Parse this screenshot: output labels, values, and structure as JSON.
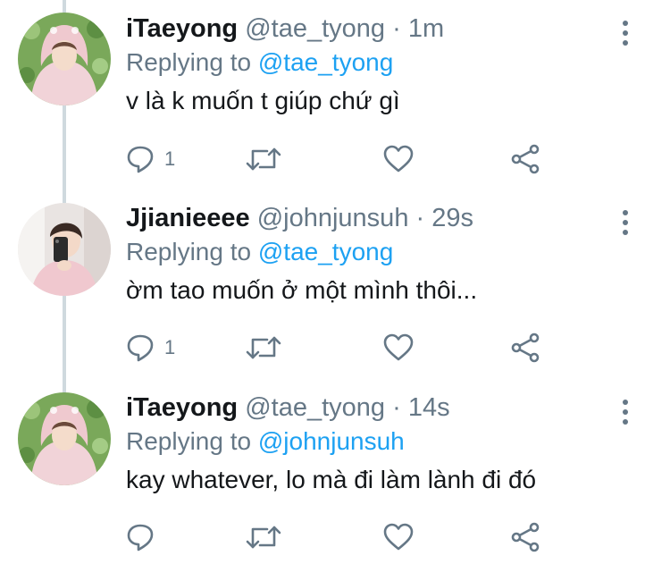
{
  "tweets": [
    {
      "display_name": "iTaeyong",
      "handle": "@tae_tyong",
      "separator": "·",
      "time": "1m",
      "replying_prefix": "Replying to",
      "replying_to": "@tae_tyong",
      "text": "v là k muốn t giúp chứ gì",
      "reply_count": "1",
      "avatar_icon": "pink-hoodie-avatar"
    },
    {
      "display_name": "Jjianieeee",
      "handle": "@johnjunsuh",
      "separator": "·",
      "time": "29s",
      "replying_prefix": "Replying to",
      "replying_to": "@tae_tyong",
      "text": "ờm tao muốn ở một mình thôi...",
      "reply_count": "1",
      "avatar_icon": "mirror-selfie-avatar"
    },
    {
      "display_name": "iTaeyong",
      "handle": "@tae_tyong",
      "separator": "·",
      "time": "14s",
      "replying_prefix": "Replying to",
      "replying_to": "@johnjunsuh",
      "text": "kay whatever, lo mà đi làm lành đi đó",
      "reply_count": "",
      "avatar_icon": "pink-hoodie-avatar"
    }
  ],
  "colors": {
    "text": "#14171a",
    "muted": "#657786",
    "link": "#1da1f2",
    "thread_line": "#cfd9de"
  }
}
